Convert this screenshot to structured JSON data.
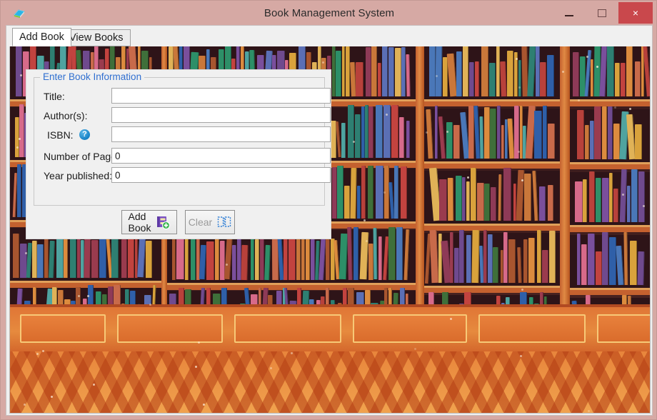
{
  "window": {
    "title": "Book Management System",
    "app_icon": "book-app-icon",
    "controls": {
      "minimize": "minimize-icon",
      "maximize": "maximize-icon",
      "close": "close-icon",
      "close_glyph": "×"
    },
    "colors": {
      "titlebar": "#d6a9a4",
      "close_button": "#c9484c",
      "client_background": "#f0f0f0",
      "group_title": "#2f6fd0",
      "accent_blue": "#1782c6"
    }
  },
  "tabs": [
    {
      "label": "Add Book",
      "active": true
    },
    {
      "label": "View Books",
      "active": false
    }
  ],
  "form": {
    "group_title": "Enter Book Information",
    "fields": [
      {
        "label": "Title:",
        "value": "",
        "placeholder": ""
      },
      {
        "label": "Author(s):",
        "value": "",
        "placeholder": ""
      },
      {
        "label": "ISBN:",
        "value": "",
        "placeholder": "",
        "help_icon": "help-circle-icon",
        "help_glyph": "?"
      },
      {
        "label": "Number of Pages:",
        "value": "0",
        "placeholder": ""
      },
      {
        "label": "Year published:",
        "value": "0",
        "placeholder": ""
      }
    ],
    "buttons": [
      {
        "label": "Add Book",
        "icon": "book-add-icon",
        "enabled": true
      },
      {
        "label": "Clear",
        "icon": "clear-selection-icon",
        "enabled": false
      }
    ]
  },
  "background": {
    "description": "library-bookshelves-illustration"
  }
}
